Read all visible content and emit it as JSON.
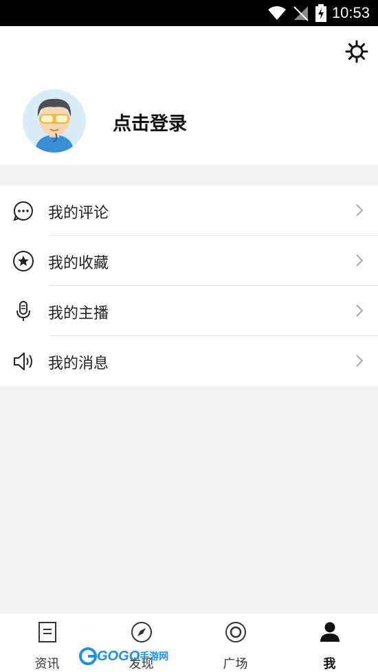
{
  "status_bar": {
    "time": "10:53"
  },
  "profile": {
    "login_label": "点击登录"
  },
  "menu": {
    "items": [
      {
        "label": "我的评论"
      },
      {
        "label": "我的收藏"
      },
      {
        "label": "我的主播"
      },
      {
        "label": "我的消息"
      }
    ]
  },
  "tabbar": {
    "tabs": [
      {
        "label": "资讯"
      },
      {
        "label": "发现"
      },
      {
        "label": "广场"
      },
      {
        "label": "我",
        "active": true
      }
    ]
  },
  "watermark": {
    "text": "GOGO",
    "cn": "手游网"
  }
}
